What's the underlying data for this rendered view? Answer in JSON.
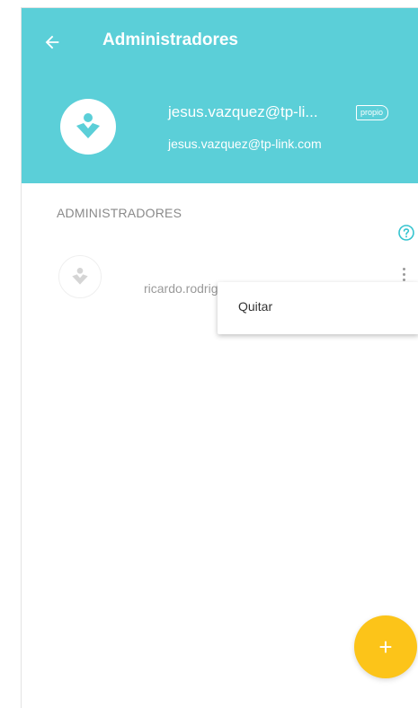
{
  "header": {
    "title": "Administradores",
    "owner_name": "jesus.vazquez@tp-li...",
    "owner_badge": "propio",
    "owner_email": "jesus.vazquez@tp-link.com"
  },
  "admins": {
    "section_label": "ADMINISTRADORES",
    "items": [
      {
        "email": "ricardo.rodriguez@tp-link.com"
      }
    ]
  },
  "popup_menu": {
    "items": [
      {
        "label": "Quitar"
      }
    ]
  },
  "fab": {
    "icon": "+"
  },
  "colors": {
    "header_bg": "#5bcfd8",
    "fab_bg": "#fcc419",
    "help_icon": "#35c4cf"
  },
  "icons": {
    "back": "arrow-left-icon",
    "avatar": "user-avatar-icon",
    "help": "help-circle-icon",
    "more": "more-vertical-icon",
    "add": "plus-icon"
  }
}
